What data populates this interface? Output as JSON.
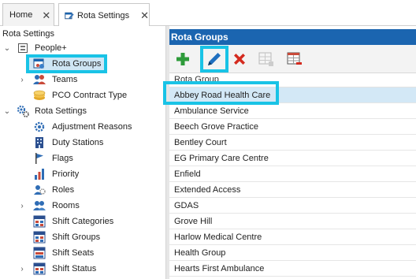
{
  "tabs": [
    {
      "label": "Home",
      "close": "✕"
    },
    {
      "label": "Rota Settings",
      "close": "✕"
    }
  ],
  "left_panel": {
    "title": "Rota Settings",
    "tree": [
      {
        "label": "People+",
        "chevron": "⌄",
        "icon": "people-plus-icon"
      },
      {
        "label": "Rota Groups",
        "icon": "rota-groups-icon",
        "selected": true
      },
      {
        "label": "Teams",
        "chevron": "›",
        "icon": "teams-icon"
      },
      {
        "label": "PCO Contract Type",
        "icon": "coins-icon"
      },
      {
        "label": "Rota Settings",
        "chevron": "⌄",
        "icon": "gears-icon"
      },
      {
        "label": "Adjustment Reasons",
        "icon": "adjustment-icon"
      },
      {
        "label": "Duty Stations",
        "icon": "building-icon"
      },
      {
        "label": "Flags",
        "icon": "flag-icon"
      },
      {
        "label": "Priority",
        "icon": "priority-icon"
      },
      {
        "label": "Roles",
        "icon": "roles-icon"
      },
      {
        "label": "Rooms",
        "chevron": "›",
        "icon": "rooms-icon"
      },
      {
        "label": "Shift Categories",
        "icon": "shift-categories-icon"
      },
      {
        "label": "Shift Groups",
        "icon": "shift-groups-icon"
      },
      {
        "label": "Shift Seats",
        "icon": "shift-seats-icon"
      },
      {
        "label": "Shift Status",
        "chevron": "›",
        "icon": "shift-status-icon"
      }
    ]
  },
  "right_panel": {
    "title": "Rota Groups",
    "toolbar": [
      "add-icon",
      "edit-pencil-icon",
      "delete-icon",
      "grid-add-icon",
      "grid-remove-icon"
    ],
    "column_header": "Rota Group",
    "rows": [
      "Abbey Road Health Care",
      "Ambulance Service",
      "Beech Grove Practice",
      "Bentley Court",
      "EG Primary Care Centre",
      "Enfield",
      "Extended Access",
      "GDAS",
      "Grove Hill",
      "Harlow Medical Centre",
      "Health Group",
      "Hearts First Ambulance"
    ],
    "selected_row": "Abbey Road Health Care"
  },
  "colors": {
    "header_blue": "#1b65b0",
    "highlight_cyan": "#19c3e6",
    "selection_blue": "#d3e8f6",
    "add_green": "#2e9b3a",
    "delete_red": "#d42a1e"
  }
}
